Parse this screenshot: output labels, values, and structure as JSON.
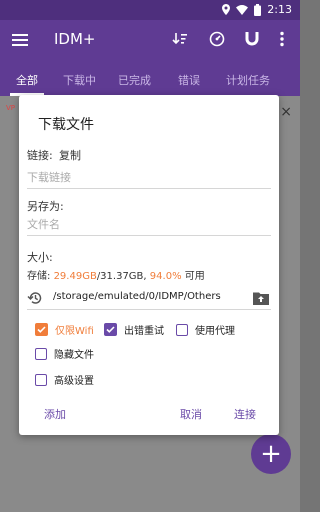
{
  "status": {
    "time": "2:13"
  },
  "appbar": {
    "title": "IDM+",
    "icons": [
      "menu-icon",
      "sort-icon",
      "speed-icon",
      "magnet-icon",
      "more-icon"
    ]
  },
  "tabs": [
    {
      "label": "全部"
    },
    {
      "label": "下载中"
    },
    {
      "label": "已完成"
    },
    {
      "label": "错误"
    },
    {
      "label": "计划任务"
    }
  ],
  "background": {
    "row_hint": "VP",
    "close": "×"
  },
  "dialog": {
    "title": "下载文件",
    "link_label": "链接:",
    "copy_label": "复制",
    "link_placeholder": "下载链接",
    "saveas_label": "另存为:",
    "filename_placeholder": "文件名",
    "size_label": "大小:",
    "storage_prefix": "存储:",
    "storage_free": "29.49GB",
    "storage_total": "/31.37GB,",
    "storage_percent": "94.0%",
    "storage_suffix": "可用",
    "path": "/storage/emulated/0/IDMP/Others",
    "options": {
      "wifi_only": {
        "label": "仅限Wifi",
        "checked": true
      },
      "retry": {
        "label": "出错重试",
        "checked": true
      },
      "proxy": {
        "label": "使用代理",
        "checked": false
      },
      "hide": {
        "label": "隐藏文件",
        "checked": false
      },
      "advanced": {
        "label": "高级设置",
        "checked": false
      }
    },
    "buttons": {
      "add": "添加",
      "cancel": "取消",
      "connect": "连接"
    }
  },
  "fab": {
    "label": "+"
  },
  "colors": {
    "primary": "#5f3b93",
    "accent_orange": "#f07d3a",
    "checkbox_purple": "#6a4aa8"
  }
}
